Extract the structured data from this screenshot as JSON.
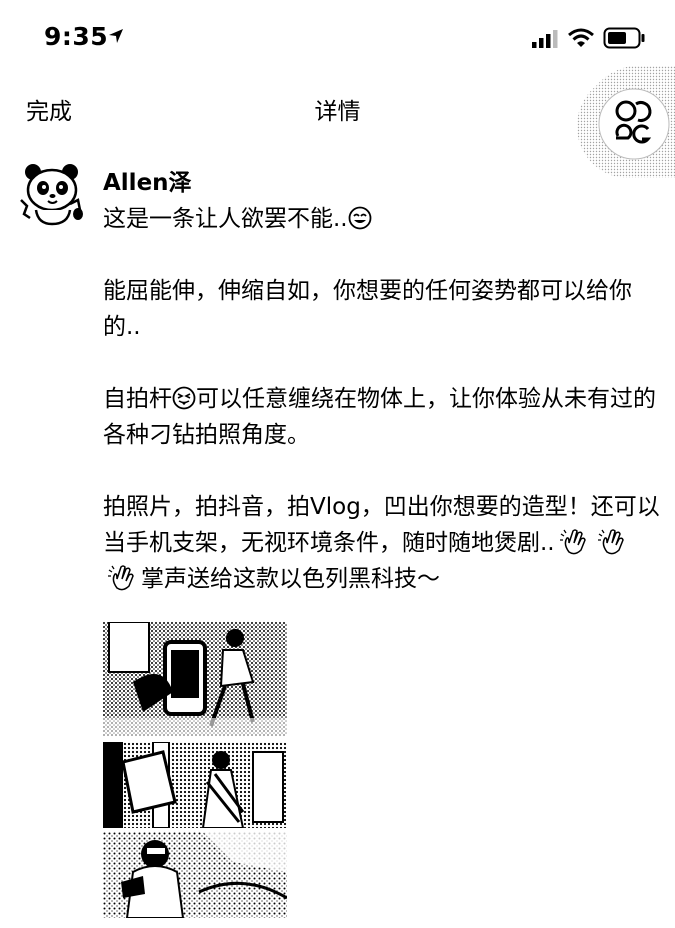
{
  "status_bar": {
    "time": "9:35"
  },
  "nav": {
    "done_label": "完成",
    "title": "详情"
  },
  "post": {
    "author": "Allen泽",
    "line1": "这是一条让人欲罢不能..",
    "para2": "能屈能伸，伸缩自如，你想要的任何姿势都可以给你的..",
    "para3_a": "自拍杆",
    "para3_b": "可以任意缠绕在物体上，让你体验从未有过的各种刁钻拍照角度。",
    "para4_a": "拍照片，拍抖音，拍Vlog，凹出你想要的造型！还可以当手机支架，无视环境条件，随时随地煲剧..",
    "para4_b": "掌声送给这款以色列黑科技～"
  },
  "icons": {
    "location": "location-arrow-icon",
    "signal": "cellular-signal-icon",
    "wifi": "wifi-icon",
    "battery": "battery-icon",
    "avatar": "panda-avatar",
    "emoji_1": "smiling-face-emoji",
    "emoji_2": "tongue-out-emoji",
    "clap": "clapping-hands-emoji"
  },
  "colors": {
    "text": "#000000",
    "background": "#ffffff"
  }
}
